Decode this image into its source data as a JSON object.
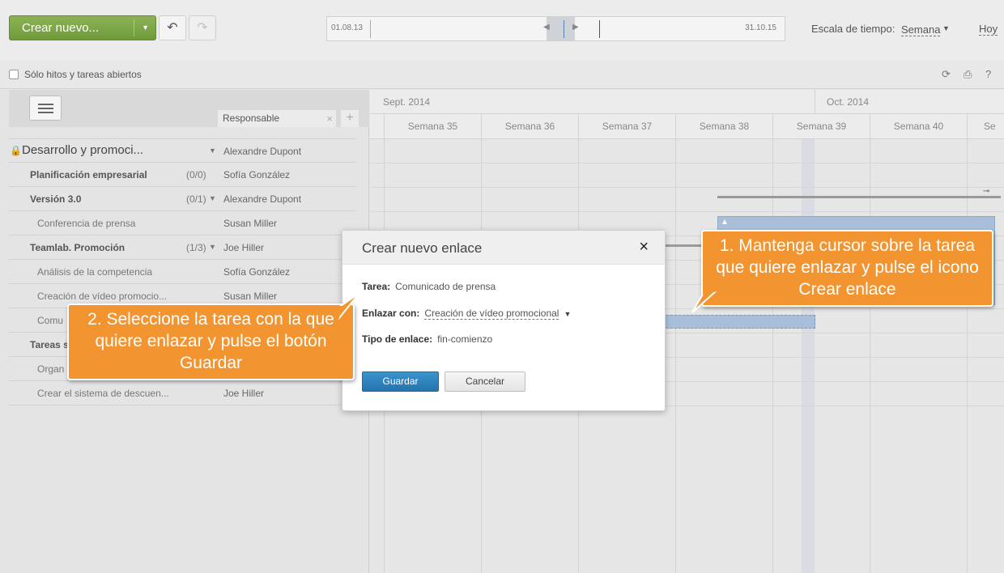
{
  "toolbar": {
    "create_label": "Crear nuevo...",
    "undo_icon": "undo-icon",
    "redo_icon": "redo-icon",
    "timeline_start": "01.08.13",
    "timeline_end": "31.10.15",
    "scale_label": "Escala de tiempo:",
    "scale_value": "Semana",
    "today_label": "Hoy"
  },
  "filter": {
    "open_only_label": "Sólo hitos y tareas abiertos",
    "icons": [
      "refresh-icon",
      "print-icon",
      "help-icon"
    ]
  },
  "left_panel": {
    "column_header": "Responsable",
    "rows": [
      {
        "type": "project",
        "name": "Desarrollo y promoci...",
        "count": "",
        "responsible": "Alexandre Dupont"
      },
      {
        "type": "ms",
        "name": "Planificación empresarial",
        "count": "(0/0)",
        "responsible": "Sofía González"
      },
      {
        "type": "ms",
        "name": "Versión 3.0",
        "count": "(0/1)",
        "responsible": "Alexandre Dupont"
      },
      {
        "type": "task",
        "name": "Conferencia de prensa",
        "count": "",
        "responsible": "Susan Miller"
      },
      {
        "type": "ms",
        "name": "Teamlab. Promoción",
        "count": "(1/3)",
        "responsible": "Joe Hiller"
      },
      {
        "type": "task",
        "name": "Análisis de la competencia",
        "count": "",
        "responsible": "Sofía González"
      },
      {
        "type": "task",
        "name": "Creación de vídeo promocio...",
        "count": "",
        "responsible": "Susan Miller"
      },
      {
        "type": "task",
        "name": "Comu",
        "count": "",
        "responsible": ""
      },
      {
        "type": "ms",
        "name": "Tareas s",
        "count": "",
        "responsible": ""
      },
      {
        "type": "task",
        "name": "Organ",
        "count": "",
        "responsible": ""
      },
      {
        "type": "task",
        "name": "Crear el sistema de descuen...",
        "count": "",
        "responsible": "Joe Hiller"
      }
    ]
  },
  "gantt": {
    "months": [
      "Sept. 2014",
      "Oct. 2014"
    ],
    "weeks": [
      "Semana 35",
      "Semana 36",
      "Semana 37",
      "Semana 38",
      "Semana 39",
      "Semana 40",
      "Se"
    ]
  },
  "dialog": {
    "title": "Crear nuevo enlace",
    "task_label": "Tarea:",
    "task_value": "Comunicado de prensa",
    "link_label": "Enlazar con:",
    "link_value": "Creación de vídeo promocional",
    "type_label": "Tipo de enlace:",
    "type_value": "fin-comienzo",
    "save_label": "Guardar",
    "cancel_label": "Cancelar"
  },
  "callouts": {
    "one": "1. Mantenga cursor sobre la tarea que quiere enlazar y pulse el icono Crear enlace",
    "two": "2. Seleccione la tarea con la que quiere enlazar y pulse el botón Guardar"
  },
  "colors": {
    "accent_green": "#7aa546",
    "callout_orange": "#f29430",
    "save_blue": "#2f84c0",
    "bar_blue": "#a9bfd9"
  }
}
